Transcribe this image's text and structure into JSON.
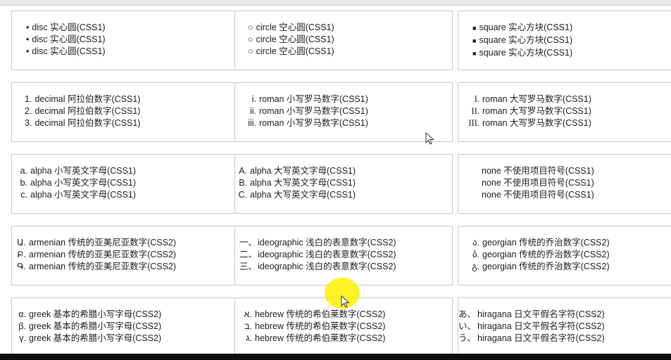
{
  "cells": [
    {
      "id": "disc",
      "marker": "•",
      "items": [
        "disc 实心圆(CSS1)",
        "disc 实心圆(CSS1)",
        "disc 实心圆(CSS1)"
      ]
    },
    {
      "id": "circle",
      "marker": "○",
      "items": [
        "circle 空心圆(CSS1)",
        "circle 空心圆(CSS1)",
        "circle 空心圆(CSS1)"
      ]
    },
    {
      "id": "square",
      "marker": "■",
      "items": [
        "square 实心方块(CSS1)",
        "square 实心方块(CSS1)",
        "square 实心方块(CSS1)"
      ]
    },
    {
      "id": "decimal",
      "markers": [
        "1.",
        "2.",
        "3."
      ],
      "items": [
        "decimal 阿拉伯数字(CSS1)",
        "decimal 阿拉伯数字(CSS1)",
        "decimal 阿拉伯数字(CSS1)"
      ]
    },
    {
      "id": "lower-roman",
      "markers": [
        "i.",
        "ii.",
        "iii."
      ],
      "items": [
        "roman 小写罗马数字(CSS1)",
        "roman 小写罗马数字(CSS1)",
        "roman 小写罗马数字(CSS1)"
      ]
    },
    {
      "id": "upper-roman",
      "markers": [
        "I.",
        "II.",
        "III."
      ],
      "items": [
        "roman 大写罗马数字(CSS1)",
        "roman 大写罗马数字(CSS1)",
        "roman 大写罗马数字(CSS1)"
      ]
    },
    {
      "id": "lower-alpha",
      "markers": [
        "a.",
        "b.",
        "c."
      ],
      "items": [
        "alpha 小写英文字母(CSS1)",
        "alpha 小写英文字母(CSS1)",
        "alpha 小写英文字母(CSS1)"
      ]
    },
    {
      "id": "upper-alpha",
      "markers": [
        "A.",
        "B.",
        "C."
      ],
      "items": [
        "alpha 大写英文字母(CSS1)",
        "alpha 大写英文字母(CSS1)",
        "alpha 大写英文字母(CSS1)"
      ]
    },
    {
      "id": "none",
      "marker": "",
      "items": [
        "none 不使用项目符号(CSS1)",
        "none 不使用项目符号(CSS1)",
        "none 不使用项目符号(CSS1)"
      ]
    },
    {
      "id": "armenian",
      "markers": [
        "Ա.",
        "Բ.",
        "Գ."
      ],
      "items": [
        "armenian 传统的亚美尼亚数字(CSS2)",
        "armenian 传统的亚美尼亚数字(CSS2)",
        "armenian 传统的亚美尼亚数字(CSS2)"
      ]
    },
    {
      "id": "ideographic",
      "markers": [
        "一、",
        "二、",
        "三、"
      ],
      "items": [
        "ideographic 浅白的表意数字(CSS2)",
        "ideographic 浅白的表意数字(CSS2)",
        "ideographic 浅白的表意数字(CSS2)"
      ]
    },
    {
      "id": "georgian",
      "markers": [
        "ა.",
        "ბ.",
        "გ."
      ],
      "items": [
        "georgian 传统的乔治数字(CSS2)",
        "georgian 传统的乔治数字(CSS2)",
        "georgian 传统的乔治数字(CSS2)"
      ]
    },
    {
      "id": "greek",
      "markers": [
        "α.",
        "β.",
        "γ."
      ],
      "items": [
        "greek 基本的希腊小写字母(CSS2)",
        "greek 基本的希腊小写字母(CSS2)",
        "greek 基本的希腊小写字母(CSS2)"
      ]
    },
    {
      "id": "hebrew",
      "markers": [
        "א.",
        "ב.",
        "ג."
      ],
      "items": [
        "hebrew 传统的希伯莱数字(CSS2)",
        "hebrew 传统的希伯莱数字(CSS2)",
        "hebrew 传统的希伯莱数字(CSS2)"
      ]
    },
    {
      "id": "hiragana",
      "markers": [
        "あ、",
        "い、",
        "う、"
      ],
      "items": [
        "hiragana 日文平假名字符(CSS2)",
        "hiragana 日文平假名字符(CSS2)",
        "hiragana 日文平假名字符(CSS2)"
      ]
    }
  ]
}
